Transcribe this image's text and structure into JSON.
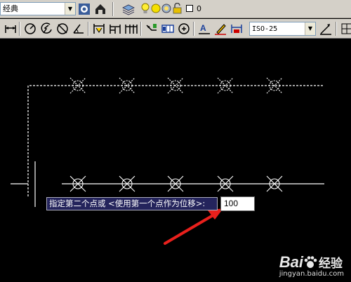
{
  "toolbar_top": {
    "style_combo_value": "经典",
    "layer_combo_value": "0"
  },
  "toolbar_bottom": {
    "dimstyle_combo_value": "ISO-25"
  },
  "command": {
    "prompt": "指定第二个点或 <使用第一个点作为位移>:",
    "input_value": "100"
  },
  "arrow_color": "#e8201c",
  "watermark": {
    "logo_text": "Bai",
    "logo_suffix": "百",
    "brand_cn": "经验",
    "url": "jingyan.baidu.com"
  }
}
